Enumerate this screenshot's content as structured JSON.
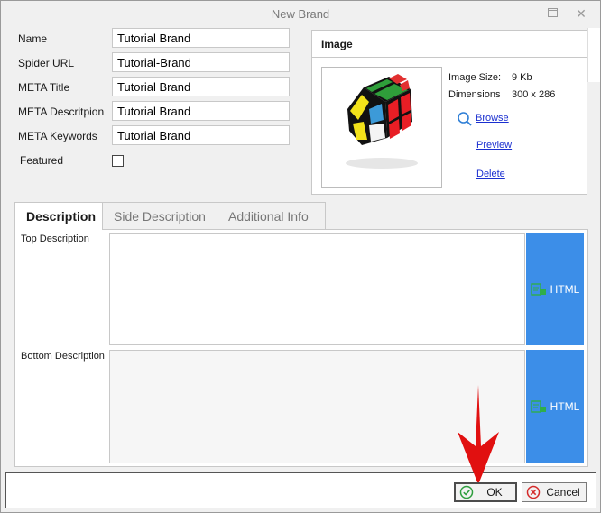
{
  "window": {
    "title": "New Brand"
  },
  "form": {
    "name": {
      "label": "Name",
      "value": "Tutorial Brand"
    },
    "spider_url": {
      "label": "Spider URL",
      "value": "Tutorial-Brand"
    },
    "meta_title": {
      "label": "META Title",
      "value": "Tutorial Brand"
    },
    "meta_description": {
      "label": "META Descritpion",
      "value": "Tutorial Brand"
    },
    "meta_keywords": {
      "label": "META Keywords",
      "value": "Tutorial Brand"
    },
    "featured": {
      "label": "Featured",
      "checked": false
    }
  },
  "image_panel": {
    "title": "Image",
    "size_label": "Image Size:",
    "size_value": "9 Kb",
    "dimensions_label": "Dimensions",
    "dimensions_value": "300 x 286",
    "browse": "Browse",
    "preview": "Preview",
    "delete": "Delete"
  },
  "tabs": [
    {
      "label": "Description",
      "active": true
    },
    {
      "label": "Side Description",
      "active": false
    },
    {
      "label": "Additional Info",
      "active": false
    }
  ],
  "description": {
    "top_label": "Top Description",
    "bottom_label": "Bottom Description",
    "html_button": "HTML"
  },
  "footer": {
    "ok": "OK",
    "cancel": "Cancel"
  },
  "colors": {
    "accent": "#3c8ee8",
    "link": "#1a2fd0",
    "arrow": "#e11010"
  }
}
